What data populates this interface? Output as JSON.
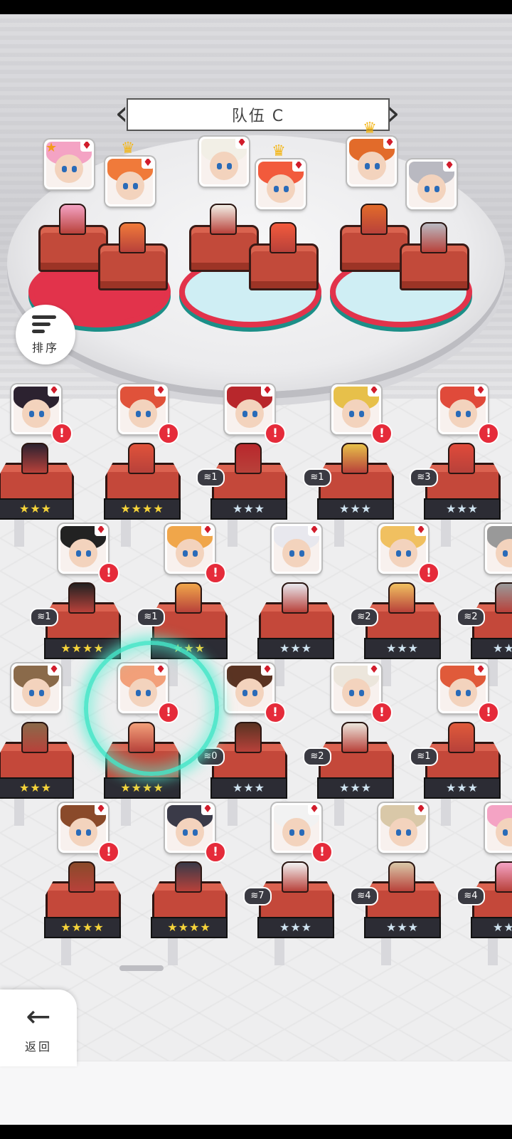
{
  "header": {
    "team_title": "队伍 C"
  },
  "sort_button": {
    "label": "排序"
  },
  "back_button": {
    "label": "返回"
  },
  "colors": {
    "accent_red": "#e52b3a",
    "pad_teal": "#1c8f88",
    "gold": "#f3b619"
  },
  "team_slots": [
    {
      "crown": false,
      "star_corner": true
    },
    {
      "crown": true,
      "star_corner": false
    },
    {
      "crown": false,
      "star_corner": false
    },
    {
      "crown": true,
      "star_corner": false
    },
    {
      "crown": true,
      "star_corner": false
    },
    {
      "crown": false,
      "star_corner": false
    }
  ],
  "roster_rows": [
    {
      "units": [
        {
          "stars": "★★★",
          "tier": "gold",
          "count": "",
          "alert": true
        },
        {
          "stars": "★★★★",
          "tier": "gold",
          "count": "",
          "alert": true
        },
        {
          "stars": "★★★",
          "tier": "silver",
          "count": "1",
          "alert": true
        },
        {
          "stars": "★★★",
          "tier": "silver",
          "count": "1",
          "alert": true
        },
        {
          "stars": "★★★",
          "tier": "silver",
          "count": "3",
          "alert": true
        }
      ]
    },
    {
      "units": [
        {
          "stars": "★★★★",
          "tier": "gold",
          "count": "1",
          "alert": true
        },
        {
          "stars": "★★★",
          "tier": "gold",
          "count": "1",
          "alert": true
        },
        {
          "stars": "★★★",
          "tier": "silver",
          "count": "",
          "alert": false
        },
        {
          "stars": "★★★",
          "tier": "silver",
          "count": "2",
          "alert": true
        },
        {
          "stars": "★★★",
          "tier": "silver",
          "count": "2",
          "alert": true
        }
      ]
    },
    {
      "units": [
        {
          "stars": "★★★",
          "tier": "gold",
          "count": "",
          "alert": false
        },
        {
          "stars": "★★★★",
          "tier": "gold",
          "count": "",
          "alert": true
        },
        {
          "stars": "★★★",
          "tier": "silver",
          "count": "0",
          "alert": true
        },
        {
          "stars": "★★★",
          "tier": "silver",
          "count": "2",
          "alert": true
        },
        {
          "stars": "★★★",
          "tier": "silver",
          "count": "1",
          "alert": true
        }
      ]
    },
    {
      "units": [
        {
          "stars": "★★★★",
          "tier": "gold",
          "count": "",
          "alert": true
        },
        {
          "stars": "★★★★",
          "tier": "gold",
          "count": "",
          "alert": true
        },
        {
          "stars": "★★★",
          "tier": "silver",
          "count": "7",
          "alert": true
        },
        {
          "stars": "★★★",
          "tier": "silver",
          "count": "4",
          "alert": false
        },
        {
          "stars": "★★★",
          "tier": "silver",
          "count": "4",
          "alert": true
        }
      ]
    }
  ]
}
